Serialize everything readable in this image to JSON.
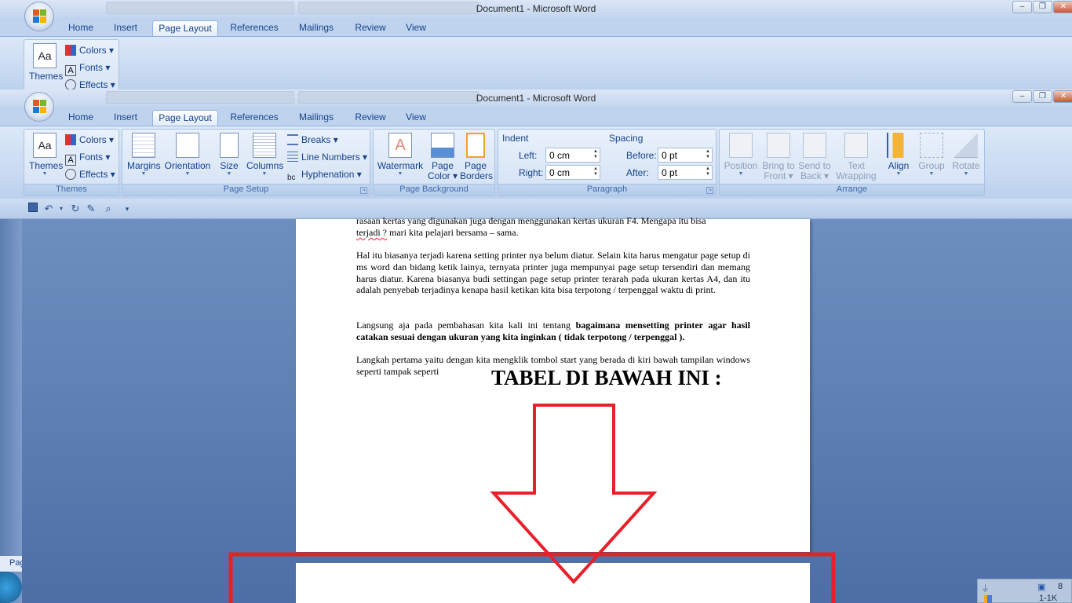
{
  "window": {
    "title": "Document1 - Microsoft Word",
    "controls": {
      "minimize": "–",
      "maximize": "❐",
      "close": "✕"
    }
  },
  "tabs": [
    "Home",
    "Insert",
    "Page Layout",
    "References",
    "Mailings",
    "Review",
    "View"
  ],
  "active_tab": "Page Layout",
  "ribbon": {
    "themes": {
      "themes_label": "Themes",
      "colors": "Colors",
      "fonts": "Fonts",
      "effects": "Effects",
      "caption": "Themes"
    },
    "page_setup": {
      "margins": "Margins",
      "orientation": "Orientation",
      "size": "Size",
      "columns": "Columns",
      "breaks": "Breaks",
      "line_numbers": "Line Numbers",
      "hyphenation": "Hyphenation",
      "caption": "Page Setup"
    },
    "page_background": {
      "watermark": "Watermark",
      "page_color_1": "Page",
      "page_color_2": "Color",
      "page_borders_1": "Page",
      "page_borders_2": "Borders",
      "caption": "Page Background"
    },
    "paragraph": {
      "indent": "Indent",
      "left_label": "Left:",
      "left_value": "0 cm",
      "right_label": "Right:",
      "right_value": "0 cm",
      "spacing": "Spacing",
      "before_label": "Before:",
      "before_value": "0 pt",
      "after_label": "After:",
      "after_value": "0 pt",
      "caption": "Paragraph"
    },
    "arrange": {
      "position": "Position",
      "bring_1": "Bring to",
      "bring_2": "Front",
      "send_1": "Send to",
      "send_2": "Back",
      "text_1": "Text",
      "text_2": "Wrapping",
      "align": "Align",
      "group": "Group",
      "rotate": "Rotate",
      "caption": "Arrange"
    }
  },
  "background_glimpses": {
    "left_top": "Pa",
    "left_bottom": "Pag"
  },
  "document": {
    "cut_line": "rasaan kertas yang digunakan juga dengan menggunakan kertas ukuran F4. Mengapa itu bisa",
    "p1_end_a": "terjadi ?",
    "p1_end_b": " mari kita pelajari bersama – sama.",
    "p2": "Hal itu biasanya terjadi karena setting printer nya belum diatur. Selain kita harus mengatur page setup di ms word dan bidang ketik lainya, ternyata printer juga mempunyai page setup tersendiri dan memang harus diatur. Karena biasanya budi settingan page setup printer terarah pada ukuran kertas A4, dan itu adalah penyebab terjadinya kenapa hasil ketikan kita bisa terpotong / terpenggal waktu di print.",
    "p3_plain": "Langsung aja pada pembahasan kita kali ini tentang ",
    "p3_bold": "bagaimana mensetting printer agar hasil catakan sesuai dengan ukuran yang kita inginkan ( tidak terpotong / terpenggal ).",
    "p4": "Langkah pertama yaitu dengan kita mengklik tombol start yang berada di kiri bawah tampilan windows seperti tampak seperti",
    "p4_big": "TABEL DI BAWAH INI :"
  },
  "tray": {
    "a": "8",
    "b": "1-1K"
  },
  "colors": {
    "annotation": "#e8202a",
    "ribbon": "#c7d9f1",
    "workspace": "#6d8fbf"
  }
}
